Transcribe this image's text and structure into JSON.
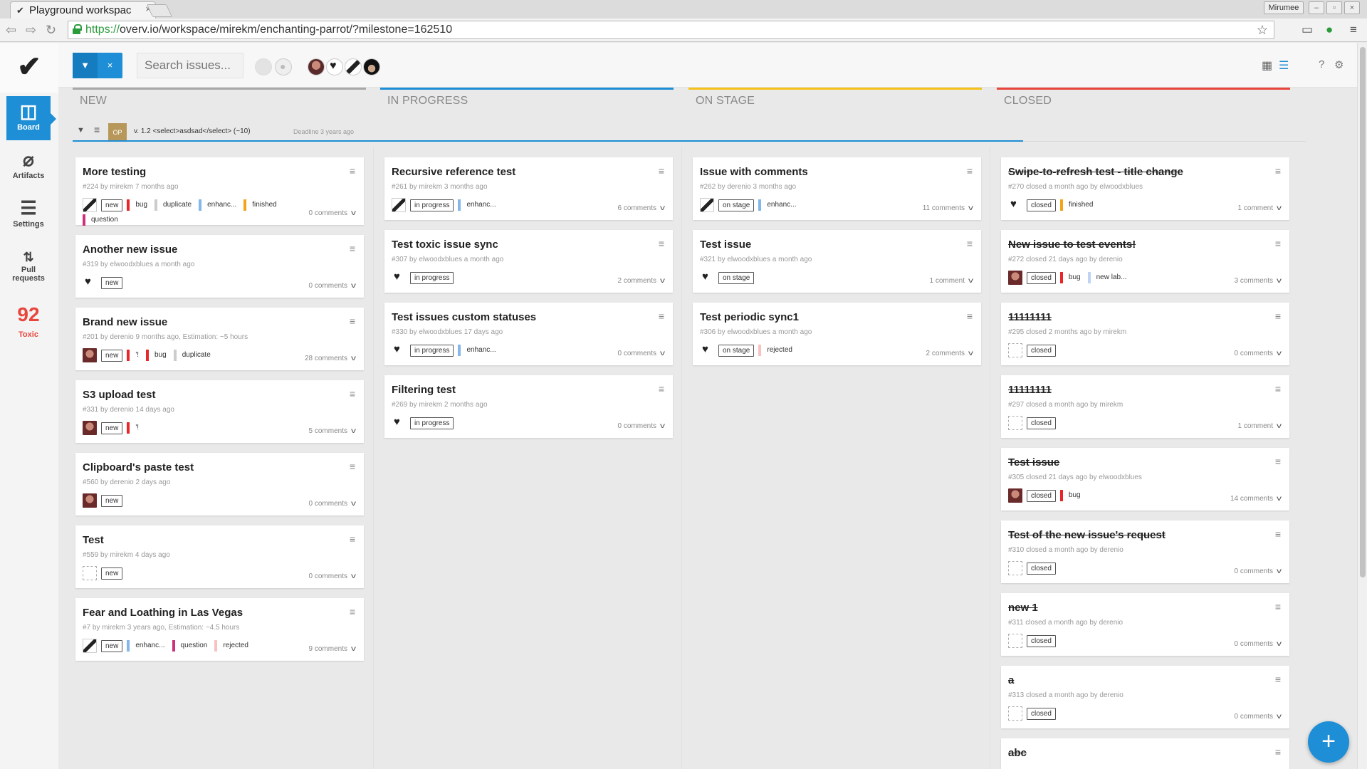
{
  "browser": {
    "tab_title": "Playground workspac",
    "url_https": "https://",
    "url_rest": "overv.io/workspace/mirekm/enchanting-parrot/?milestone=162510",
    "profile": "Mirumee"
  },
  "rail": {
    "items": [
      {
        "label": "Board",
        "icon": "board-icon"
      },
      {
        "label": "Artifacts",
        "icon": "paperclip-icon"
      },
      {
        "label": "Settings",
        "icon": "sliders-icon"
      },
      {
        "label": "Pull requests",
        "icon": "pull-request-icon"
      }
    ],
    "toxic_count": "92",
    "toxic_label": "Toxic"
  },
  "appbar": {
    "search_placeholder": "Search issues...",
    "accent": "#1e8ed6"
  },
  "columns": [
    {
      "name": "NEW",
      "color": "#a8a8a8"
    },
    {
      "name": "IN PROGRESS",
      "color": "#1e8ed6"
    },
    {
      "name": "ON STAGE",
      "color": "#f4c21a"
    },
    {
      "name": "CLOSED",
      "color": "#e8453c"
    }
  ],
  "milestone": {
    "badge": "OP",
    "title": "v. 1.2 <select>asdsad</select> (~10)",
    "deadline": "Deadline 3 years ago"
  },
  "cards": {
    "new": [
      {
        "title": "More testing",
        "meta": "#224 by mirekm 7 months ago",
        "status": "new",
        "labels": [
          "bug",
          "duplicate",
          "enhanc...",
          "finished"
        ],
        "labels2": [
          "question"
        ],
        "comments": "0 comments"
      },
      {
        "title": "Another new issue",
        "meta": "#319 by elwoodxblues a month ago",
        "status": "new",
        "labels": [],
        "comments": "0 comments"
      },
      {
        "title": "Brand new issue",
        "meta": "#201 by derenio 9 months ago, Estimation: ~5 hours",
        "status": "new",
        "labels": [
          "'!",
          "bug",
          "duplicate"
        ],
        "comments": "28 comments"
      },
      {
        "title": "S3 upload test",
        "meta": "#331 by derenio 14 days ago",
        "status": "new",
        "labels": [
          "'!"
        ],
        "comments": "5 comments"
      },
      {
        "title": "Clipboard's paste test",
        "meta": "#560 by derenio 2 days ago",
        "status": "new",
        "labels": [],
        "comments": "0 comments"
      },
      {
        "title": "Test",
        "meta": "#559 by mirekm 4 days ago",
        "status": "new",
        "labels": [],
        "comments": "0 comments"
      },
      {
        "title": "Fear and Loathing in Las Vegas",
        "meta": "#7 by mirekm 3 years ago, Estimation: ~4.5 hours",
        "status": "new",
        "labels": [
          "enhanc...",
          "question",
          "rejected"
        ],
        "comments": "9 comments"
      }
    ],
    "progress": [
      {
        "title": "Recursive reference test",
        "meta": "#261 by mirekm 3 months ago",
        "status": "in progress",
        "labels": [
          "enhanc..."
        ],
        "comments": "6 comments"
      },
      {
        "title": "Test toxic issue sync",
        "meta": "#307 by elwoodxblues a month ago",
        "status": "in progress",
        "labels": [],
        "comments": "2 comments"
      },
      {
        "title": "Test issues custom statuses",
        "meta": "#330 by elwoodxblues 17 days ago",
        "status": "in progress",
        "labels": [
          "enhanc..."
        ],
        "comments": "0 comments"
      },
      {
        "title": "Filtering test",
        "meta": "#269 by mirekm 2 months ago",
        "status": "in progress",
        "labels": [],
        "comments": "0 comments"
      }
    ],
    "stage": [
      {
        "title": "Issue with comments",
        "meta": "#262 by derenio 3 months ago",
        "status": "on stage",
        "labels": [
          "enhanc..."
        ],
        "comments": "11 comments"
      },
      {
        "title": "Test issue",
        "meta": "#321 by elwoodxblues a month ago",
        "status": "on stage",
        "labels": [],
        "comments": "1 comment"
      },
      {
        "title": "Test periodic sync1",
        "meta": "#306 by elwoodxblues a month ago",
        "status": "on stage",
        "labels": [
          "rejected"
        ],
        "comments": "2 comments"
      }
    ],
    "closed": [
      {
        "title": "Swipe-to-refresh test - title change",
        "meta": "#270 closed a month ago by elwoodxblues",
        "status": "closed",
        "labels": [
          "finished"
        ],
        "comments": "1 comment"
      },
      {
        "title": "New issue to test events!",
        "meta": "#272 closed 21 days ago by derenio",
        "status": "closed",
        "labels": [
          "bug",
          "new lab..."
        ],
        "comments": "3 comments"
      },
      {
        "title": "11111111",
        "meta": "#295 closed 2 months ago by mirekm",
        "status": "closed",
        "labels": [],
        "comments": "0 comments"
      },
      {
        "title": "11111111",
        "meta": "#297 closed a month ago by mirekm",
        "status": "closed",
        "labels": [],
        "comments": "1 comment"
      },
      {
        "title": "Test issue",
        "meta": "#305 closed 21 days ago by elwoodxblues",
        "status": "closed",
        "labels": [
          "bug"
        ],
        "comments": "14 comments"
      },
      {
        "title": "Test of the new issue's request",
        "meta": "#310 closed a month ago by derenio",
        "status": "closed",
        "labels": [],
        "comments": "0 comments"
      },
      {
        "title": "new 1",
        "meta": "#311 closed a month ago by derenio",
        "status": "closed",
        "labels": [],
        "comments": "0 comments"
      },
      {
        "title": "a",
        "meta": "#313 closed a month ago by derenio",
        "status": "closed",
        "labels": [],
        "comments": "0 comments"
      },
      {
        "title": "abc",
        "meta": "",
        "status": "",
        "labels": [],
        "comments": ""
      }
    ]
  },
  "label_colors": {
    "bug": "#e8272a",
    "duplicate": "#cccccc",
    "enhanc...": "#84b6eb",
    "finished": "#f4a41a",
    "question": "#cc317c",
    "rejected": "#f9c2c2",
    "'!": "#e8272a",
    "new lab...": "#bfd4f2"
  }
}
